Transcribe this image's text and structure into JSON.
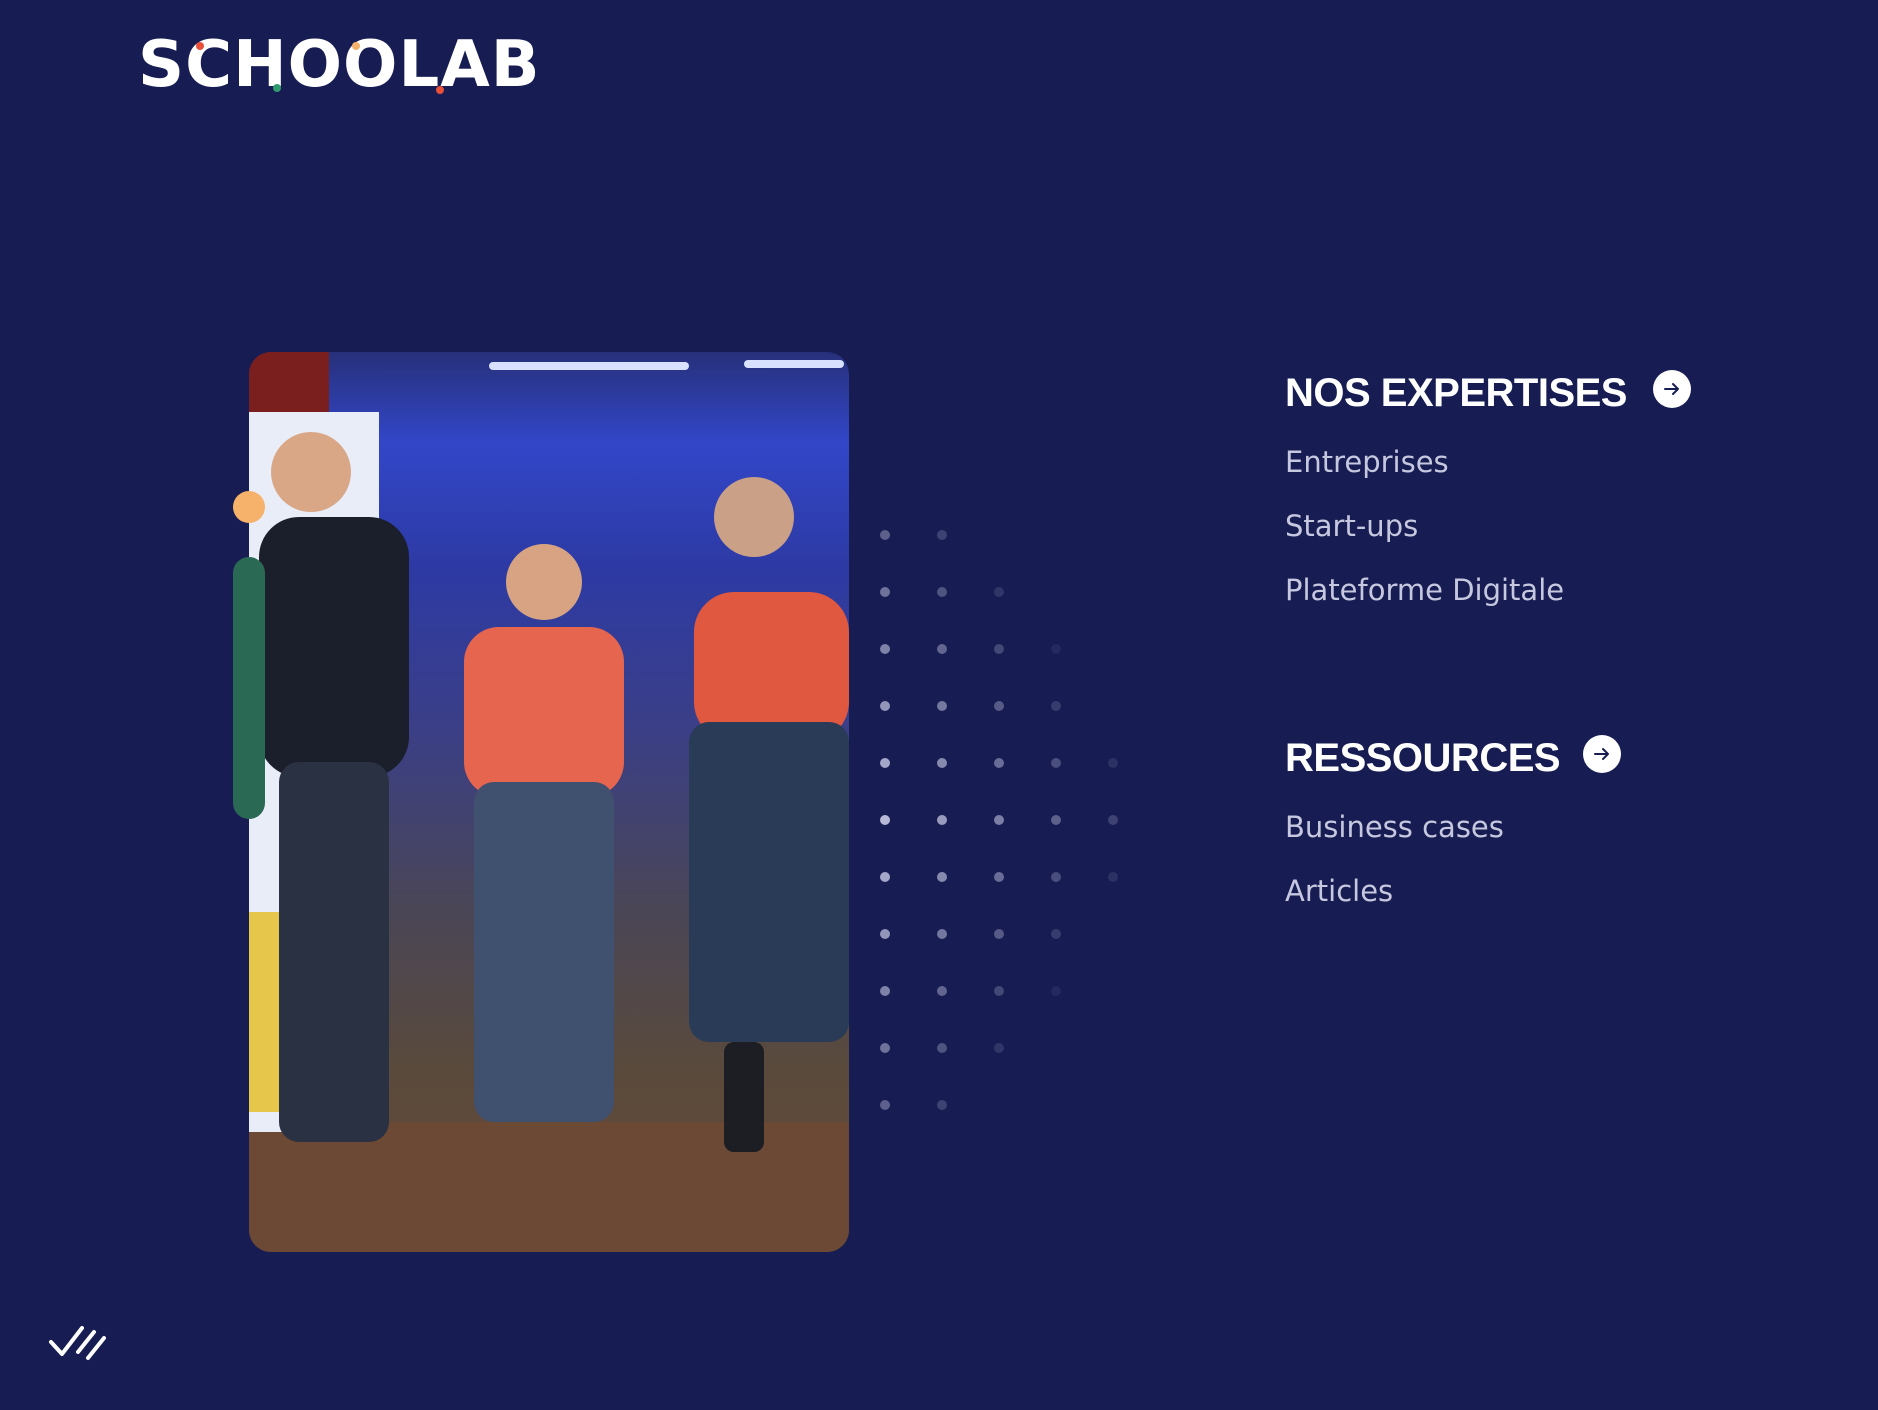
{
  "brand": {
    "name": "SCHOOLAB"
  },
  "colors": {
    "background": "#171c52",
    "text_primary": "#ffffff",
    "text_secondary": "#c6c8df",
    "accent_orange": "#f6b26b",
    "accent_green": "#2a6a55"
  },
  "menu": {
    "sections": [
      {
        "title": "NOS EXPERTISES",
        "icon": "arrow-right-icon",
        "links": [
          "Entreprises",
          "Start-ups",
          "Plateforme Digitale"
        ]
      },
      {
        "title": "RESSOURCES",
        "icon": "arrow-right-icon",
        "links": [
          "Business cases",
          "Articles"
        ]
      }
    ]
  },
  "footer": {
    "icon": "check-marks-icon"
  }
}
